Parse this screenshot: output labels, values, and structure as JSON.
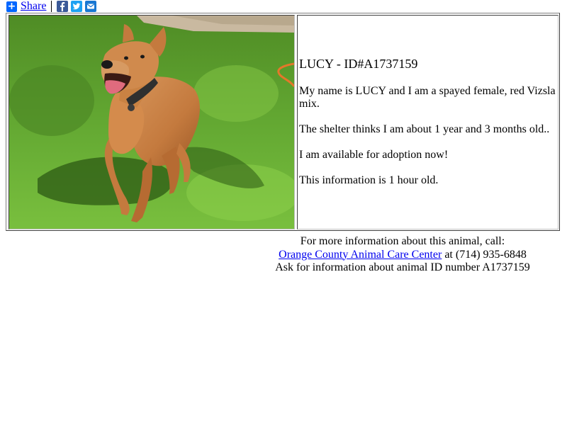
{
  "share": {
    "label": "Share",
    "icons": [
      "plus-icon",
      "facebook-icon",
      "twitter-icon",
      "email-icon"
    ]
  },
  "animal": {
    "title": "LUCY - ID#A1737159",
    "intro": "My name is LUCY and I am a spayed female, red Vizsla mix.",
    "age": "The shelter thinks I am about 1 year and 3 months old..",
    "availability": "I am available for adoption now!",
    "freshness": "This information is 1 hour old."
  },
  "contact": {
    "line1": "For more information about this animal, call:",
    "center_name": "Orange County Animal Care Center",
    "phone_text": " at (714) 935-6848",
    "line3": "Ask for information about animal ID number A1737159"
  },
  "colors": {
    "link": "#0000ee",
    "share_blue": "#0166ff",
    "facebook": "#3b5998",
    "twitter": "#1da1f2",
    "email": "#1977d2"
  }
}
